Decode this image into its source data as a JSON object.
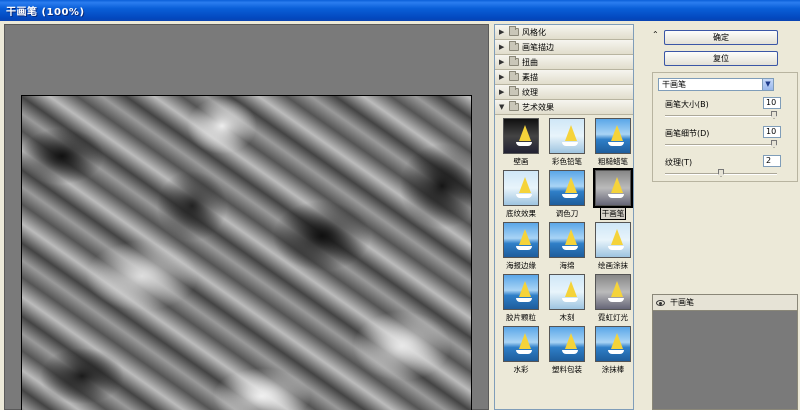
{
  "window": {
    "title": "干画笔 (100%)"
  },
  "gallery": {
    "categories_top": [
      {
        "label": "风格化"
      },
      {
        "label": "画笔描边"
      },
      {
        "label": "扭曲"
      },
      {
        "label": "素描"
      },
      {
        "label": "纹理"
      }
    ],
    "expanded_category": {
      "label": "艺术效果"
    },
    "filters": [
      {
        "label": "壁画",
        "style": "dark"
      },
      {
        "label": "彩色铅笔",
        "style": "pale"
      },
      {
        "label": "粗糙蜡笔",
        "style": "normal"
      },
      {
        "label": "底纹效果",
        "style": "pale"
      },
      {
        "label": "调色刀",
        "style": "normal"
      },
      {
        "label": "干画笔",
        "style": "gray",
        "selected": true
      },
      {
        "label": "海报边缘",
        "style": "normal"
      },
      {
        "label": "海绵",
        "style": "normal"
      },
      {
        "label": "绘画涂抹",
        "style": "pale"
      },
      {
        "label": "胶片颗粒",
        "style": "normal"
      },
      {
        "label": "木刻",
        "style": "pale"
      },
      {
        "label": "霓虹灯光",
        "style": "gray"
      },
      {
        "label": "水彩",
        "style": "normal"
      },
      {
        "label": "塑料包装",
        "style": "normal"
      },
      {
        "label": "涂抹棒",
        "style": "normal"
      }
    ]
  },
  "panel": {
    "ok_label": "确定",
    "reset_label": "复位",
    "selected_filter": "干画笔",
    "params": [
      {
        "label": "画笔大小(B)",
        "value": "10",
        "fraction": 1.0
      },
      {
        "label": "画笔细节(D)",
        "value": "10",
        "fraction": 1.0
      },
      {
        "label": "纹理(T)",
        "value": "2",
        "fraction": 0.5
      }
    ],
    "layer_label": "干画笔"
  }
}
